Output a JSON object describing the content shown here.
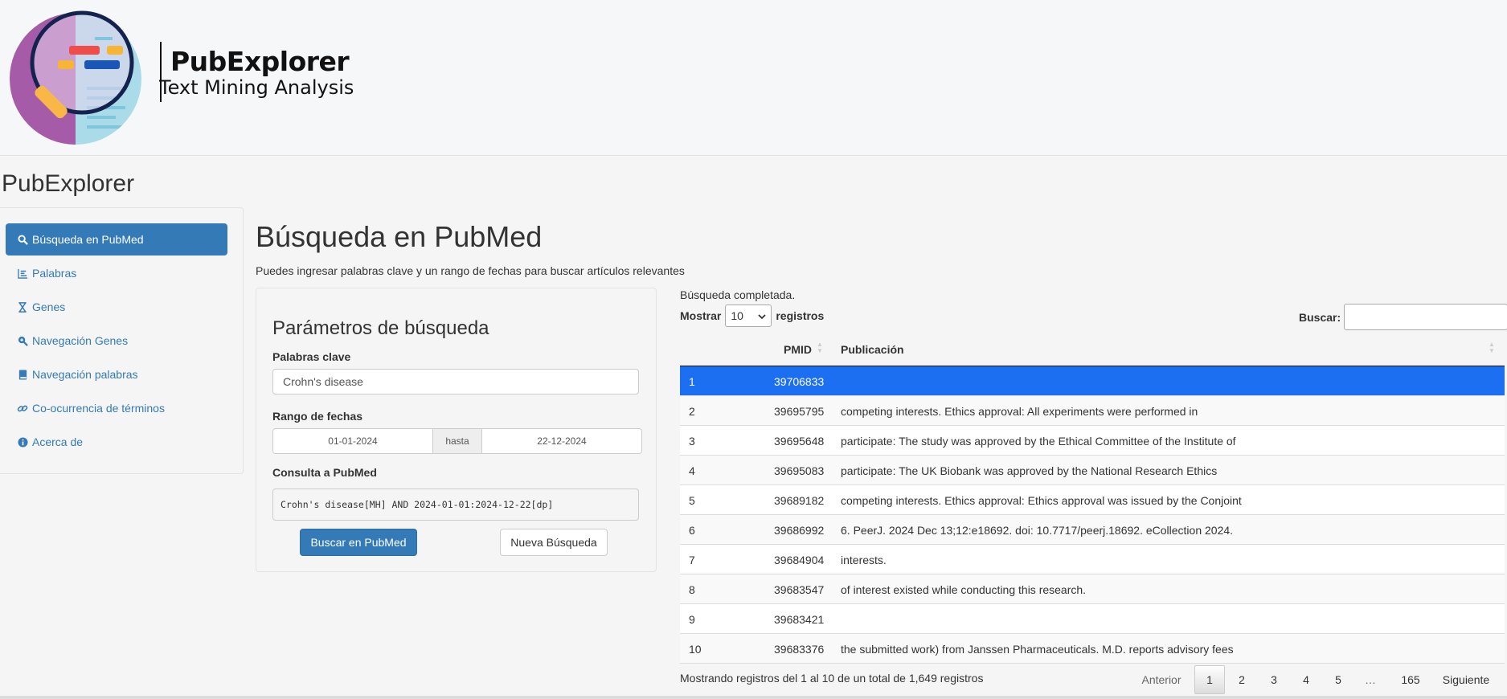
{
  "logo": {
    "title": "PubExplorer",
    "subtitle": "Text Mining Analysis"
  },
  "app_title": "PubExplorer",
  "sidebar": {
    "items": [
      {
        "label": "Búsqueda en PubMed",
        "icon": "search-icon",
        "active": true
      },
      {
        "label": "Palabras",
        "icon": "bar-chart-icon",
        "active": false
      },
      {
        "label": "Genes",
        "icon": "hourglass-icon",
        "active": false
      },
      {
        "label": "Navegación Genes",
        "icon": "search-plus-icon",
        "active": false
      },
      {
        "label": "Navegación palabras",
        "icon": "book-icon",
        "active": false
      },
      {
        "label": "Co-ocurrencia de términos",
        "icon": "link-icon",
        "active": false
      },
      {
        "label": "Acerca de",
        "icon": "info-circle-icon",
        "active": false
      }
    ]
  },
  "main": {
    "title": "Búsqueda en PubMed",
    "description": "Puedes ingresar palabras clave y un rango de fechas para buscar artículos relevantes"
  },
  "params": {
    "title": "Parámetros de búsqueda",
    "keywords_label": "Palabras clave",
    "keywords_value": "Crohn's disease",
    "daterange_label": "Rango de fechas",
    "date_start": "01-01-2024",
    "date_sep": "hasta",
    "date_end": "22-12-2024",
    "query_label": "Consulta a PubMed",
    "query_value": "Crohn's disease[MH] AND 2024-01-01:2024-12-22[dp]",
    "search_button": "Buscar en PubMed",
    "new_button": "Nueva Búsqueda"
  },
  "results": {
    "status": "Búsqueda completada.",
    "length_prefix": "Mostrar",
    "length_value": "10",
    "length_suffix": "registros",
    "search_label": "Buscar:",
    "columns": [
      "PMID",
      "Publicación"
    ],
    "rows": [
      {
        "n": "1",
        "pmid": "39706833",
        "pub": "",
        "selected": true
      },
      {
        "n": "2",
        "pmid": "39695795",
        "pub": "competing interests. Ethics approval: All experiments were performed in"
      },
      {
        "n": "3",
        "pmid": "39695648",
        "pub": "participate: The study was approved by the Ethical Committee of the Institute of"
      },
      {
        "n": "4",
        "pmid": "39695083",
        "pub": "participate: The UK Biobank was approved by the National Research Ethics"
      },
      {
        "n": "5",
        "pmid": "39689182",
        "pub": "competing interests. Ethics approval: Ethics approval was issued by the Conjoint"
      },
      {
        "n": "6",
        "pmid": "39686992",
        "pub": "6. PeerJ. 2024 Dec 13;12:e18692. doi: 10.7717/peerj.18692. eCollection 2024."
      },
      {
        "n": "7",
        "pmid": "39684904",
        "pub": "interests."
      },
      {
        "n": "8",
        "pmid": "39683547",
        "pub": "of interest existed while conducting this research."
      },
      {
        "n": "9",
        "pmid": "39683421",
        "pub": ""
      },
      {
        "n": "10",
        "pmid": "39683376",
        "pub": "the submitted work) from Janssen Pharmaceuticals. M.D. reports advisory fees"
      }
    ],
    "info": "Mostrando registros del 1 al 10 de un total de 1,649 registros",
    "pagination": {
      "previous": "Anterior",
      "pages": [
        "1",
        "2",
        "3",
        "4",
        "5",
        "…",
        "165"
      ],
      "current": "1",
      "next": "Siguiente"
    }
  },
  "colors": {
    "accent": "#337ab7",
    "selected_row": "#1d6ff2"
  }
}
